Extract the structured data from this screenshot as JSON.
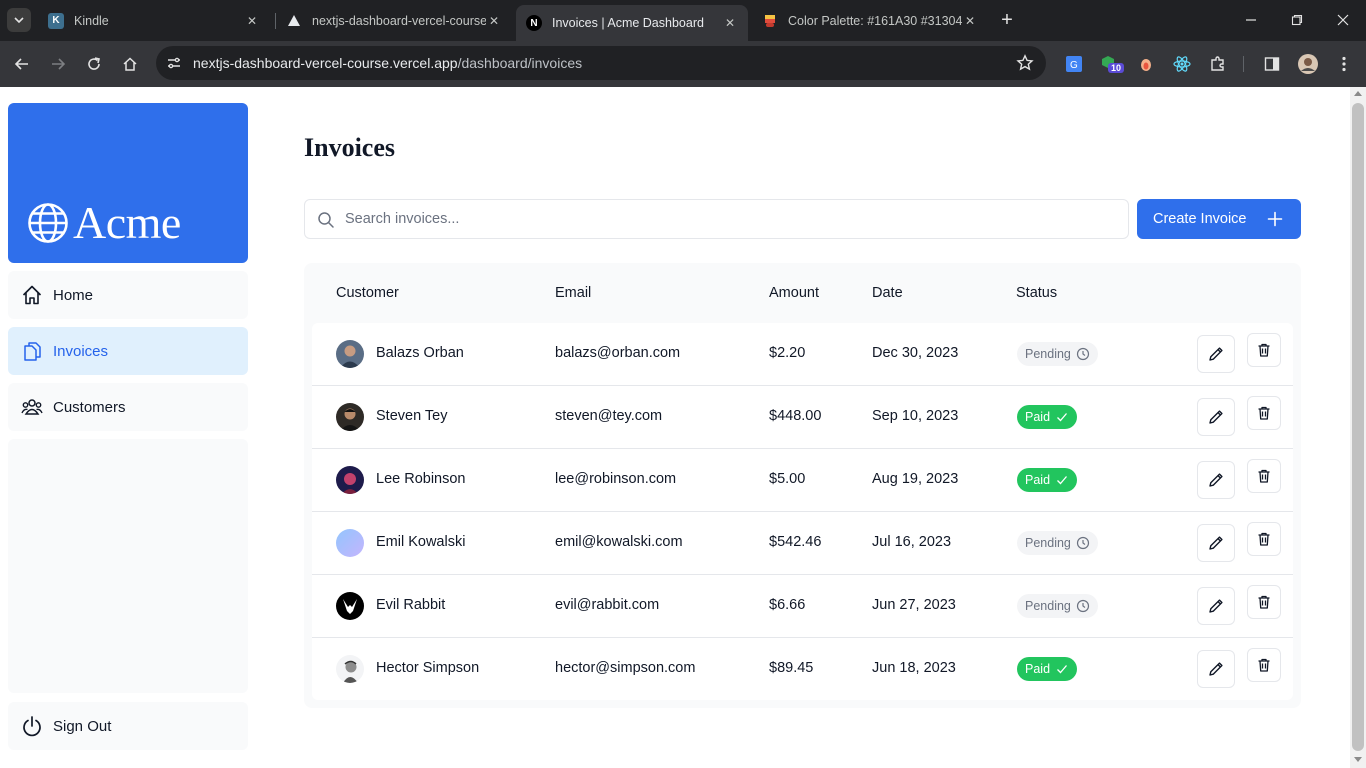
{
  "browser": {
    "tabs": [
      {
        "title": "Kindle",
        "favicon": "kindle-icon",
        "active": false
      },
      {
        "title": "nextjs-dashboard-vercel-course",
        "favicon": "vercel-icon",
        "active": false
      },
      {
        "title": "Invoices | Acme Dashboard",
        "favicon": "nextjs-icon",
        "active": true
      },
      {
        "title": "Color Palette: #161A30 #31304",
        "favicon": "palette-icon",
        "active": false
      }
    ],
    "url_host": "nextjs-dashboard-vercel-course.vercel.app",
    "url_path": "/dashboard/invoices",
    "extension_badge": "10"
  },
  "sidebar": {
    "logo_text": "Acme",
    "links": [
      {
        "label": "Home",
        "icon": "home-icon"
      },
      {
        "label": "Invoices",
        "icon": "document-icon"
      },
      {
        "label": "Customers",
        "icon": "users-icon"
      }
    ],
    "sign_out": "Sign Out"
  },
  "main": {
    "title": "Invoices",
    "search_placeholder": "Search invoices...",
    "create_button": "Create Invoice",
    "columns": [
      "Customer",
      "Email",
      "Amount",
      "Date",
      "Status"
    ],
    "invoices": [
      {
        "name": "Balazs Orban",
        "email": "balazs@orban.com",
        "amount": "$2.20",
        "date": "Dec 30, 2023",
        "status": "Pending"
      },
      {
        "name": "Steven Tey",
        "email": "steven@tey.com",
        "amount": "$448.00",
        "date": "Sep 10, 2023",
        "status": "Paid"
      },
      {
        "name": "Lee Robinson",
        "email": "lee@robinson.com",
        "amount": "$5.00",
        "date": "Aug 19, 2023",
        "status": "Paid"
      },
      {
        "name": "Emil Kowalski",
        "email": "emil@kowalski.com",
        "amount": "$542.46",
        "date": "Jul 16, 2023",
        "status": "Pending"
      },
      {
        "name": "Evil Rabbit",
        "email": "evil@rabbit.com",
        "amount": "$6.66",
        "date": "Jun 27, 2023",
        "status": "Pending"
      },
      {
        "name": "Hector Simpson",
        "email": "hector@simpson.com",
        "amount": "$89.45",
        "date": "Jun 18, 2023",
        "status": "Paid"
      }
    ]
  },
  "colors": {
    "brand_blue": "#2f6feb",
    "paid_green": "#22c55e",
    "pending_gray": "#f3f4f6",
    "active_link_bg": "#e0f0fd"
  }
}
